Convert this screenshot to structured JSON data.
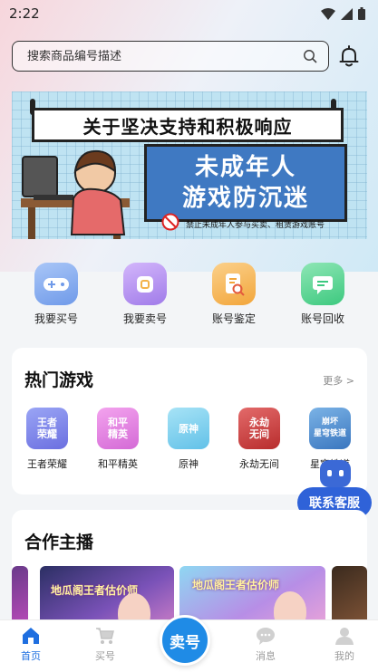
{
  "status_bar": {
    "time": "2:22"
  },
  "search": {
    "placeholder": "搜索商品编号描述"
  },
  "banner": {
    "title": "关于坚决支持和积极响应",
    "line1": "未成年人",
    "line2": "游戏防沉迷",
    "note": "禁止未成年人参与买卖、租赁游戏账号"
  },
  "quick_actions": [
    {
      "label": "我要买号",
      "icon": "gamepad-icon",
      "color": "#7aa7ee"
    },
    {
      "label": "我要卖号",
      "icon": "tag-icon",
      "color": "#b48cf0"
    },
    {
      "label": "账号鉴定",
      "icon": "appraise-doc-icon",
      "color": "#f5b04a"
    },
    {
      "label": "账号回收",
      "icon": "recycle-chat-icon",
      "color": "#4ed08e"
    }
  ],
  "hot_games": {
    "title": "热门游戏",
    "more": "更多 >",
    "games": [
      {
        "name": "王者荣耀",
        "logo_text": "王者\n荣耀",
        "color": "#7f8ef0"
      },
      {
        "name": "和平精英",
        "logo_text": "和平\n精英",
        "color": "#e880e0"
      },
      {
        "name": "原神",
        "logo_text": "原神",
        "color": "#7fd2ef"
      },
      {
        "name": "永劫无间",
        "logo_text": "永劫\n无间",
        "color": "#d64545"
      },
      {
        "name": "星穹铁道",
        "logo_text": "崩坏\n星穹铁道",
        "color": "#4f8fd0"
      }
    ]
  },
  "customer_service": {
    "label": "联系客服"
  },
  "partners": {
    "title": "合作主播",
    "streams": [
      {
        "title": "地瓜阁王者估价师"
      },
      {
        "title": "地瓜阁王者估价师"
      }
    ]
  },
  "tab_bar": {
    "home": "首页",
    "buy": "买号",
    "sell": "卖号",
    "messages": "消息",
    "mine": "我的"
  }
}
